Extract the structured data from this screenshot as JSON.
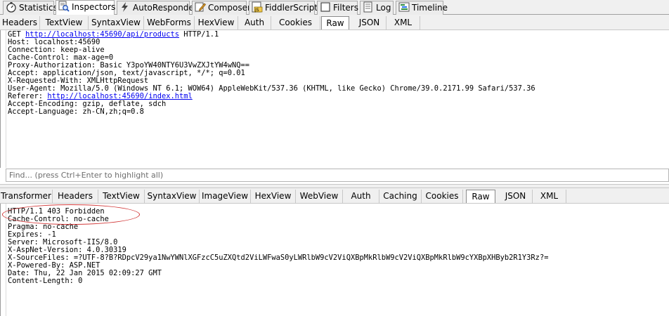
{
  "main_tabs": [
    {
      "label": "Statistics",
      "icon": "stopwatch-icon"
    },
    {
      "label": "Inspectors",
      "icon": "magnifier-icon",
      "active": true
    },
    {
      "label": "AutoResponder",
      "icon": "lightning-icon"
    },
    {
      "label": "Composer",
      "icon": "pencil-icon"
    },
    {
      "label": "FiddlerScript",
      "icon": "script-icon"
    },
    {
      "label": "Filters",
      "icon": "checkbox-icon"
    },
    {
      "label": "Log",
      "icon": "log-icon"
    },
    {
      "label": "Timeline",
      "icon": "timeline-icon"
    }
  ],
  "request": {
    "tabs": [
      "Headers",
      "TextView",
      "SyntaxView",
      "WebForms",
      "HexView",
      "Auth",
      "Cookies",
      "Raw",
      "JSON",
      "XML"
    ],
    "active_tab": "Raw",
    "line1_method": "GET ",
    "line1_url": "http://localhost:45690/api/products",
    "line1_proto": " HTTP/1.1",
    "lines_a": [
      "Host: localhost:45690",
      "Connection: keep-alive",
      "Cache-Control: max-age=0",
      "Proxy-Authorization: Basic Y3poYW40NTY6U3VwZXJtYW4wNQ==",
      "Accept: application/json, text/javascript, */*; q=0.01",
      "X-Requested-With: XMLHttpRequest",
      "User-Agent: Mozilla/5.0 (Windows NT 6.1; WOW64) AppleWebKit/537.36 (KHTML, like Gecko) Chrome/39.0.2171.99 Safari/537.36"
    ],
    "referer_label": "Referer: ",
    "referer_url": "http://localhost:45690/index.html",
    "lines_b": [
      "Accept-Encoding: gzip, deflate, sdch",
      "Accept-Language: zh-CN,zh;q=0.8"
    ],
    "find_placeholder": "Find... (press Ctrl+Enter to highlight all)"
  },
  "response": {
    "tabs": [
      "Transformer",
      "Headers",
      "TextView",
      "SyntaxView",
      "ImageView",
      "HexView",
      "WebView",
      "Auth",
      "Caching",
      "Cookies",
      "Raw",
      "JSON",
      "XML"
    ],
    "active_tab": "Raw",
    "lines": [
      "HTTP/1.1 403 Forbidden",
      "Cache-Control: no-cache",
      "Pragma: no-cache",
      "Expires: -1",
      "Server: Microsoft-IIS/8.0",
      "X-AspNet-Version: 4.0.30319",
      "X-SourceFiles: =?UTF-8?B?RDpcV29ya1NwYWNlXGFzcC5uZXQtd2ViLWFwaS0yLWRlbW9cV2ViQXBpMkRlbW9cV2ViQXBpMkRlbW9cYXBpXHByb2R1Y3Rz?=",
      "X-Powered-By: ASP.NET",
      "Date: Thu, 22 Jan 2015 02:09:27 GMT",
      "Content-Length: 0"
    ]
  },
  "colors": {
    "link": "#0000ee",
    "annotation": "#d23a3a"
  }
}
